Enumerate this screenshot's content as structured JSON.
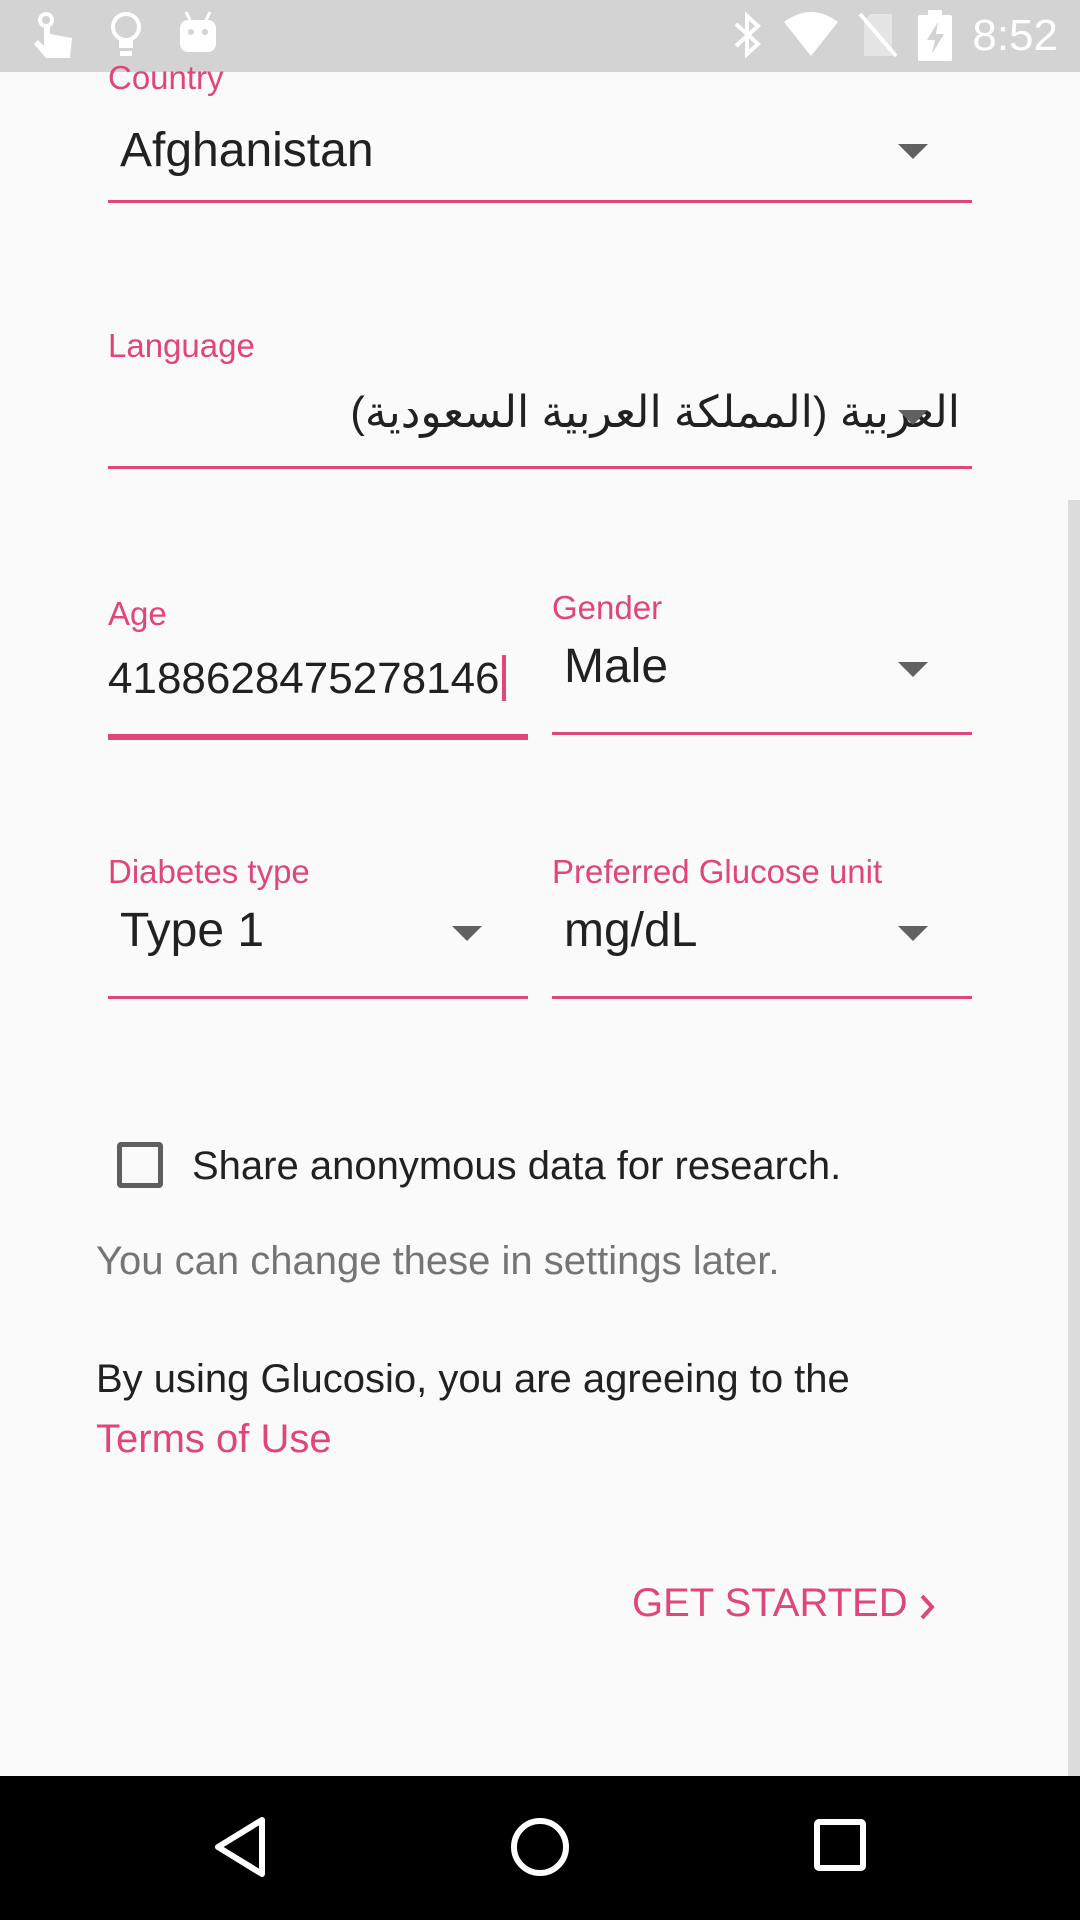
{
  "status_bar": {
    "time": "8:52",
    "left_icons": [
      "touch-hand-icon",
      "lightbulb-icon",
      "android-icon"
    ],
    "right_icons": [
      "bluetooth-icon",
      "wifi-icon",
      "no-sim-icon",
      "battery-charging-icon"
    ]
  },
  "form": {
    "country": {
      "label": "Country",
      "value": "Afghanistan"
    },
    "language": {
      "label": "Language",
      "value": "العربية (المملكة العربية السعودية)"
    },
    "age": {
      "label": "Age",
      "value": "418862847527814​6"
    },
    "gender": {
      "label": "Gender",
      "value": "Male"
    },
    "diabetes_type": {
      "label": "Diabetes type",
      "value": "Type 1"
    },
    "glucose_unit": {
      "label": "Preferred Glucose unit",
      "value": "mg/dL"
    },
    "share_checkbox": {
      "label": "Share anonymous data for research.",
      "checked": false
    },
    "settings_note": "You can change these in settings later.",
    "terms_prefix": "By using Glucosio, you are agreeing to the",
    "terms_link": "Terms of Use",
    "get_started": "GET STARTED"
  },
  "colors": {
    "accent": "#e0457b",
    "background": "#fafafa",
    "status_bar": "#d3d3d3",
    "nav_bar": "#000000"
  },
  "nav_bar": {
    "buttons": [
      "back-icon",
      "home-icon",
      "recents-icon"
    ]
  }
}
